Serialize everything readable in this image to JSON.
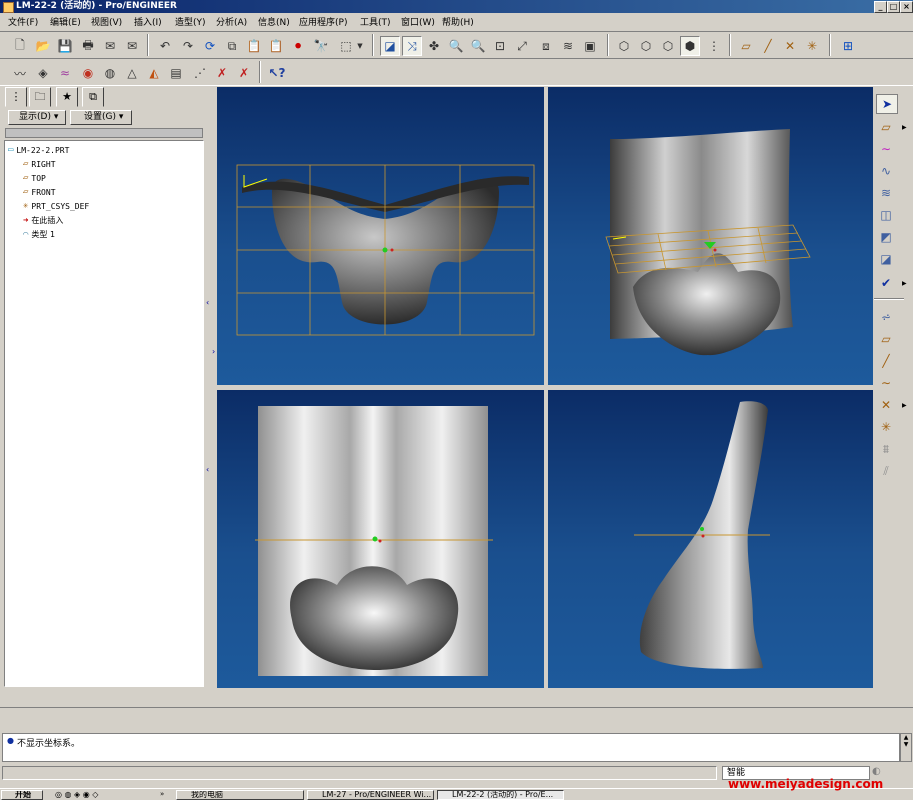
{
  "window": {
    "title": "LM-22-2 (活动的) - Pro/ENGINEER",
    "minimize": "_",
    "restore": "□",
    "close": "×"
  },
  "menu": [
    "文件(F)",
    "编辑(E)",
    "视图(V)",
    "插入(I)",
    "造型(Y)",
    "分析(A)",
    "信息(N)",
    "应用程序(P)",
    "工具(T)",
    "窗口(W)",
    "帮助(H)"
  ],
  "left_panel": {
    "show_label": "显示(D) ▾",
    "settings_label": "设置(G) ▾",
    "tree": [
      {
        "icon": "part-icon",
        "label": "LM-22-2.PRT"
      },
      {
        "icon": "datum-plane-icon",
        "label": "RIGHT"
      },
      {
        "icon": "datum-plane-icon",
        "label": "TOP"
      },
      {
        "icon": "datum-plane-icon",
        "label": "FRONT"
      },
      {
        "icon": "csys-icon",
        "label": "PRT_CSYS_DEF"
      },
      {
        "icon": "insert-here-icon",
        "label": "在此插入"
      },
      {
        "icon": "style-feature-icon",
        "label": "类型 1"
      }
    ]
  },
  "message": "不显示坐标系。",
  "status": {
    "filter": "智能"
  },
  "taskbar": {
    "start": "开始",
    "items": [
      "我的电脑",
      "LM-27 - Pro/ENGINEER Wi...",
      "LM-22-2 (活动的) - Pro/E..."
    ]
  },
  "watermark": "www.meiyadesign.com",
  "colors": {
    "viewport_top": "#0b2c66",
    "viewport_bottom": "#1d5a9c",
    "titlebar": "#0a246a"
  }
}
